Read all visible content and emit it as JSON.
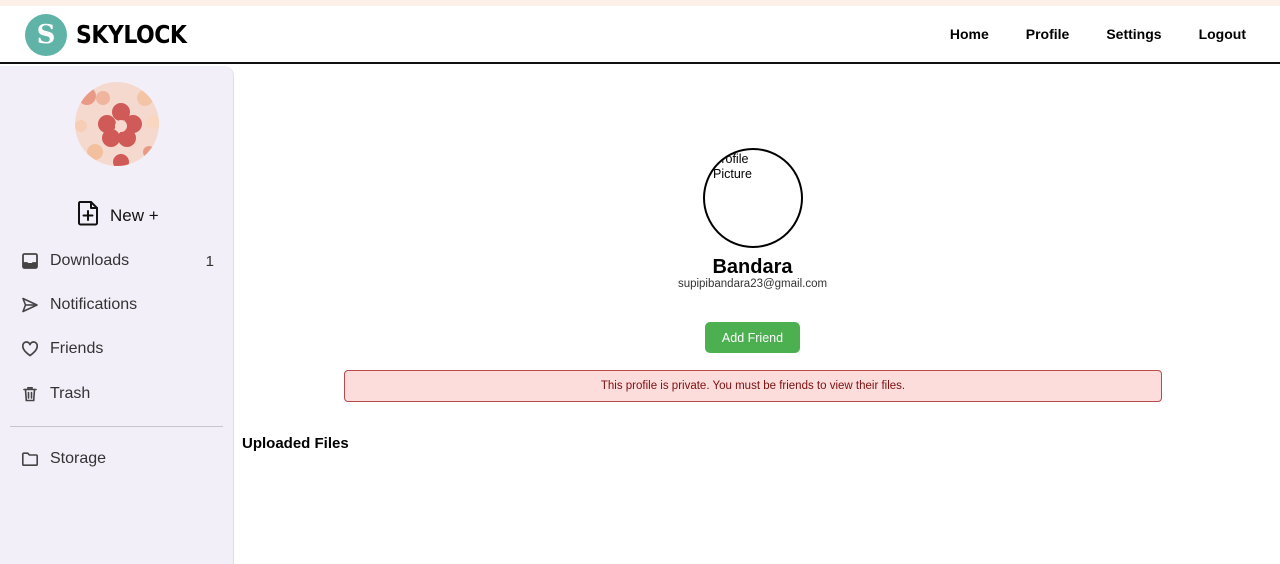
{
  "app": {
    "logo_letter": "S",
    "logo_text": "SKYLOCK",
    "brand_color": "#5fb3a7"
  },
  "nav": {
    "items": [
      {
        "label": "Home"
      },
      {
        "label": "Profile"
      },
      {
        "label": "Settings"
      },
      {
        "label": "Logout"
      }
    ]
  },
  "sidebar": {
    "new_label": "New +",
    "new_icon": "file-plus-icon",
    "items": [
      {
        "label": "Downloads",
        "icon": "inbox-icon",
        "count": "1"
      },
      {
        "label": "Notifications",
        "icon": "send-icon",
        "count": ""
      },
      {
        "label": "Friends",
        "icon": "heart-icon",
        "count": ""
      },
      {
        "label": "Trash",
        "icon": "trash-icon",
        "count": ""
      },
      {
        "label": "Storage",
        "icon": "folder-icon",
        "count": ""
      }
    ]
  },
  "profile": {
    "picture_alt": "Profile Picture",
    "name": "Bandara",
    "email": "supipibandara23@gmail.com",
    "add_friend_label": "Add Friend",
    "add_friend_color": "#4caf50",
    "private_notice": "This profile is private. You must be friends to view their files.",
    "uploaded_heading": "Uploaded Files"
  }
}
